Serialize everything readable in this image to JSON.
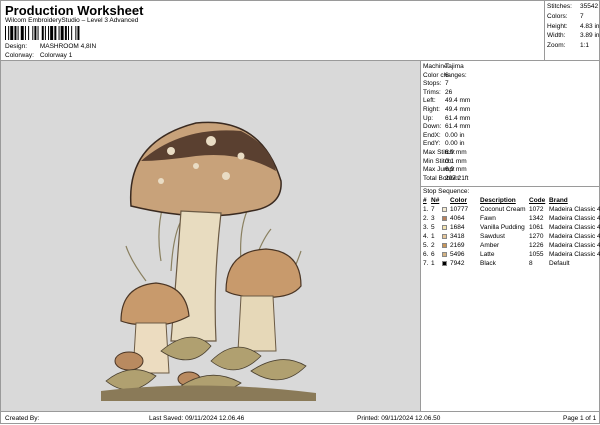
{
  "header": {
    "title": "Production Worksheet",
    "subtitle": "Wilcom EmbroideryStudio – Level 3 Advanced",
    "design_label": "Design:",
    "design_value": "MASHROOM 4,8IN",
    "colorway_label": "Colorway:",
    "colorway_value": "Colorway 1"
  },
  "stats": [
    {
      "label": "Stitches:",
      "value": "35542"
    },
    {
      "label": "Colors:",
      "value": "7"
    },
    {
      "label": "Height:",
      "value": "4.83 in"
    },
    {
      "label": "Width:",
      "value": "3.89 in"
    },
    {
      "label": "Zoom:",
      "value": "1:1"
    }
  ],
  "machine_info": [
    {
      "label": "Machine:",
      "value": "Tajima"
    },
    {
      "label": "Color changes:",
      "value": "6"
    },
    {
      "label": "Stops:",
      "value": "7"
    },
    {
      "label": "Trims:",
      "value": "26"
    },
    {
      "label": "Left:",
      "value": "49.4 mm"
    },
    {
      "label": "Right:",
      "value": "49.4 mm"
    },
    {
      "label": "Up:",
      "value": "61.4 mm"
    },
    {
      "label": "Down:",
      "value": "61.4 mm"
    },
    {
      "label": "EndX:",
      "value": "0.00 in"
    },
    {
      "label": "EndY:",
      "value": "0.00 in"
    },
    {
      "label": "Max Stitch:",
      "value": "6.9 mm"
    },
    {
      "label": "Min Stitch:",
      "value": "0.1 mm"
    },
    {
      "label": "Max Jump:",
      "value": "6.9 mm"
    },
    {
      "label": "Total Bobbin:",
      "value": "207.21ft"
    }
  ],
  "stop_sequence": {
    "title": "Stop Sequence:",
    "headers": {
      "num": "#",
      "n": "N#",
      "color": "Color",
      "description": "Description",
      "code": "Code",
      "brand": "Brand"
    },
    "rows": [
      {
        "num": "1.",
        "n": "7",
        "color": "10777",
        "description": "Coconut Cream",
        "code": "1072",
        "brand": "Madeira Classic 40",
        "swatch": "#f4ead0"
      },
      {
        "num": "2.",
        "n": "3",
        "color": "4064",
        "description": "Fawn",
        "code": "1342",
        "brand": "Madeira Classic 40",
        "swatch": "#b9805a"
      },
      {
        "num": "3.",
        "n": "5",
        "color": "1684",
        "description": "Vanilla Pudding",
        "code": "1061",
        "brand": "Madeira Classic 40",
        "swatch": "#f3e3b0"
      },
      {
        "num": "4.",
        "n": "1",
        "color": "3418",
        "description": "Sawdust",
        "code": "1270",
        "brand": "Madeira Classic 40",
        "swatch": "#e6c79a"
      },
      {
        "num": "5.",
        "n": "2",
        "color": "2169",
        "description": "Amber",
        "code": "1226",
        "brand": "Madeira Classic 40",
        "swatch": "#c8965a"
      },
      {
        "num": "6.",
        "n": "6",
        "color": "5496",
        "description": "Latte",
        "code": "1055",
        "brand": "Madeira Classic 40",
        "swatch": "#d4b384"
      },
      {
        "num": "7.",
        "n": "1",
        "color": "7942",
        "description": "Black",
        "code": "8",
        "brand": "Default",
        "swatch": "#000000"
      }
    ]
  },
  "footer": {
    "created_by": "Created By:",
    "last_saved": "Last Saved: 09/11/2024 12.06.46",
    "printed": "Printed: 09/11/2024 12.06.50",
    "page": "Page 1 of 1"
  }
}
